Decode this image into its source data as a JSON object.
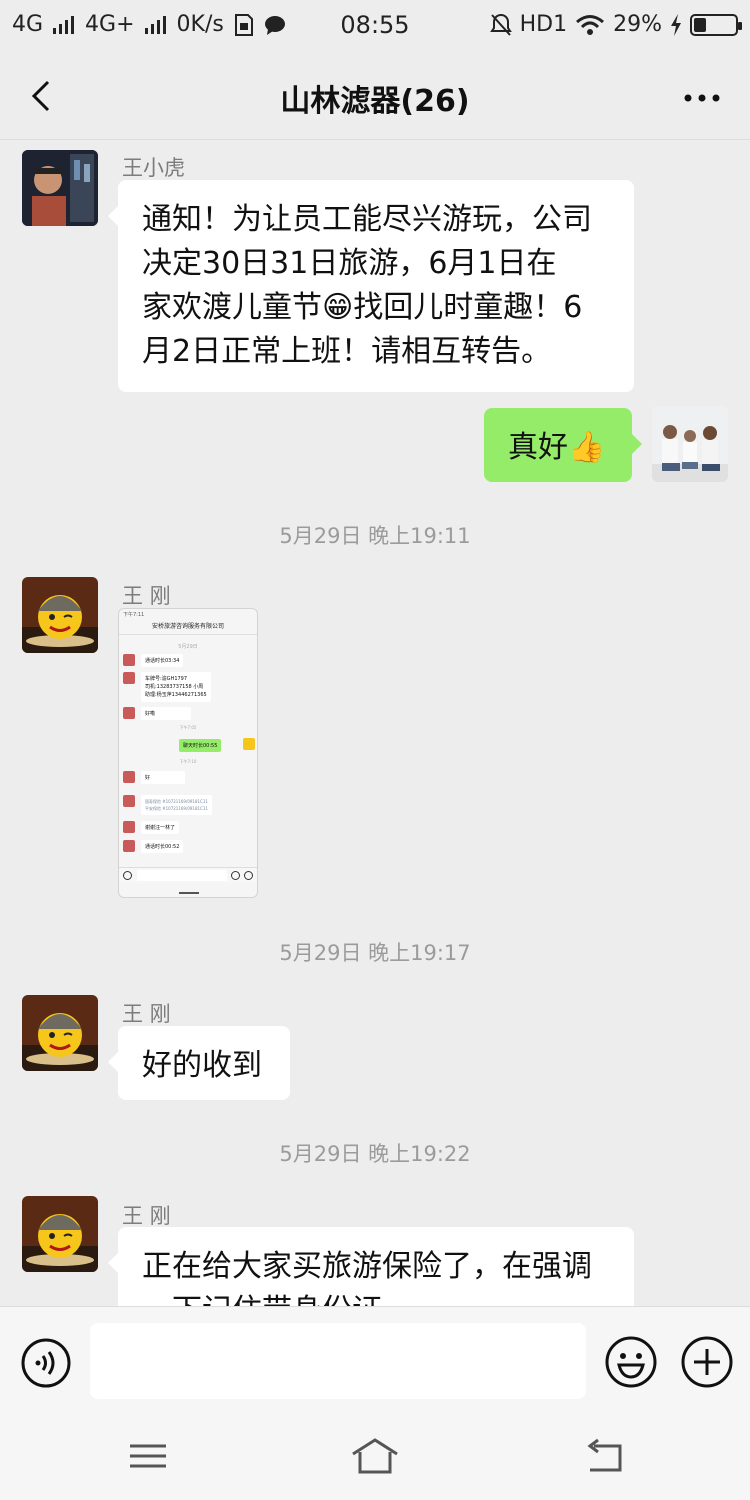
{
  "status": {
    "net1": "4G",
    "net2": "4G+",
    "speed": "0K/s",
    "time": "08:55",
    "hd": "HD1",
    "battery": "29%",
    "battery_level": 0.29
  },
  "header": {
    "title": "山林滤器(26)"
  },
  "messages": [
    {
      "sender": "王小虎",
      "text_lines": [
        "通知！为让员工能尽兴游玩，公司",
        "决定30日31日旅游，6月1日在",
        "家欢渡儿童节😁找回儿时童趣！6",
        "月2日正常上班！请相互转告。"
      ]
    },
    {
      "text": "真好👍"
    },
    {
      "timestamp": "5月29日 晚上19:11"
    },
    {
      "sender": "王 刚",
      "image": "screenshot-thumbnail",
      "shot": {
        "time": "下午7:11",
        "header": "安桥旅游咨询服务有限公司",
        "date1": "5月29日",
        "msg1": "通话时长03:34",
        "msg2_lines": [
          "车牌号:渝GH1797",
          "司机:13283737158 小周",
          "助理:杨玉萍13446271365"
        ],
        "msg3": "好嘞",
        "time2": "下午7:05",
        "msg4": "聊天时长00:55",
        "date2": "下午7:10",
        "msg5": "好",
        "msg6_lines": [
          "国寿保险 #10721169/09181C11",
          "平安保险 #10721169/09181C11"
        ],
        "msg7": "谢谢汪一林了",
        "msg8": "通话时长00:52"
      }
    },
    {
      "timestamp": "5月29日 晚上19:17"
    },
    {
      "sender": "王 刚",
      "text": "好的收到"
    },
    {
      "timestamp": "5月29日 晚上19:22"
    },
    {
      "sender": "王 刚",
      "text_lines": [
        "正在给大家买旅游保险了，在强调",
        "一下记住带身份证"
      ]
    }
  ],
  "input": {
    "placeholder": ""
  },
  "icons": {
    "back": "back-arrow-icon",
    "more": "more-dots-icon",
    "voice": "voice-icon",
    "emoji": "emoji-icon",
    "plus": "plus-icon",
    "menu": "menu-icon",
    "home": "home-icon",
    "return": "return-icon"
  }
}
